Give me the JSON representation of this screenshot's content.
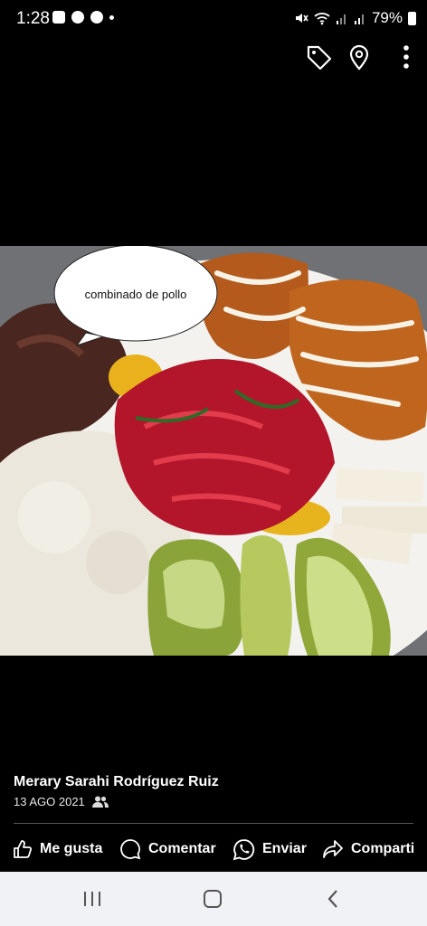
{
  "status_bar": {
    "time": "1:28",
    "battery": "79%"
  },
  "top_actions": {
    "icons": [
      "tag-icon",
      "location-pin-icon",
      "more-vert-icon"
    ]
  },
  "photo": {
    "bubble_text": "combinado de pollo"
  },
  "post": {
    "author": "Merary Sarahi Rodríguez Ruiz",
    "date": "13 AGO 2021",
    "audience_icon": "friends-icon"
  },
  "actions": {
    "like": "Me gusta",
    "comment": "Comentar",
    "send": "Enviar",
    "share": "Comparti"
  },
  "colors": {
    "background": "#000000",
    "nav_bar": "#f1f2f6",
    "text": "#ffffff"
  }
}
